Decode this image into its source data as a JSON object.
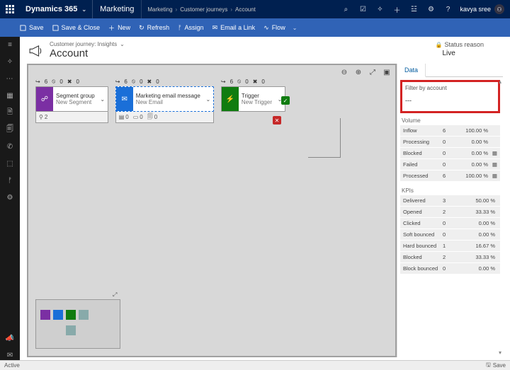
{
  "top": {
    "product": "Dynamics 365",
    "app": "Marketing",
    "breadcrumb": [
      "Marketing",
      "Customer journeys",
      "Account"
    ],
    "user": "kavya sree"
  },
  "cmd": {
    "save": "Save",
    "saveClose": "Save & Close",
    "new": "New",
    "refresh": "Refresh",
    "assign": "Assign",
    "emailLink": "Email a Link",
    "flow": "Flow"
  },
  "header": {
    "sub": "Customer journey: Insights",
    "title": "Account",
    "statusLabel": "Status reason",
    "statusValue": "Live"
  },
  "stages": [
    {
      "in": "6",
      "stop": "0",
      "err": "0",
      "badgeColor": "#7b2fa3",
      "badgeGlyph": "☍",
      "title": "Segment group",
      "subtitle": "New Segment",
      "subrow": [
        {
          "icon": "⚲",
          "n": "2"
        }
      ]
    },
    {
      "in": "6",
      "stop": "0",
      "err": "0",
      "badgeColor": "#1a6fd8",
      "badgeGlyph": "✉",
      "title": "Marketing email message",
      "subtitle": "New Email",
      "subrow": [
        {
          "icon": "▤",
          "n": "0"
        },
        {
          "icon": "▭",
          "n": "0"
        },
        {
          "icon": "🗐",
          "n": "0"
        }
      ],
      "selected": true
    },
    {
      "in": "6",
      "stop": "0",
      "err": "0",
      "badgeColor": "#107c10",
      "badgeGlyph": "⚡",
      "title": "Trigger",
      "subtitle": "New Trigger"
    }
  ],
  "side": {
    "tab": "Data",
    "filterLabel": "Filter by account",
    "filterValue": "---",
    "volume": {
      "title": "Volume",
      "rows": [
        {
          "k": "Inflow",
          "v1": "6",
          "v2": "100.00 %",
          "icon": ""
        },
        {
          "k": "Processing",
          "v1": "0",
          "v2": "0.00 %",
          "icon": ""
        },
        {
          "k": "Blocked",
          "v1": "0",
          "v2": "0.00 %",
          "icon": "▦"
        },
        {
          "k": "Failed",
          "v1": "0",
          "v2": "0.00 %",
          "icon": "▦"
        },
        {
          "k": "Processed",
          "v1": "6",
          "v2": "100.00 %",
          "icon": "▦"
        }
      ]
    },
    "kpis": {
      "title": "KPIs",
      "rows": [
        {
          "k": "Delivered",
          "v1": "3",
          "v2": "50.00 %"
        },
        {
          "k": "Opened",
          "v1": "2",
          "v2": "33.33 %"
        },
        {
          "k": "Clicked",
          "v1": "0",
          "v2": "0.00 %"
        },
        {
          "k": "Soft bounced",
          "v1": "0",
          "v2": "0.00 %"
        },
        {
          "k": "Hard bounced",
          "v1": "1",
          "v2": "16.67 %"
        },
        {
          "k": "Blocked",
          "v1": "2",
          "v2": "33.33 %"
        },
        {
          "k": "Block bounced",
          "v1": "0",
          "v2": "0.00 %"
        }
      ]
    }
  },
  "status": {
    "left": "Active",
    "save": "Save"
  }
}
